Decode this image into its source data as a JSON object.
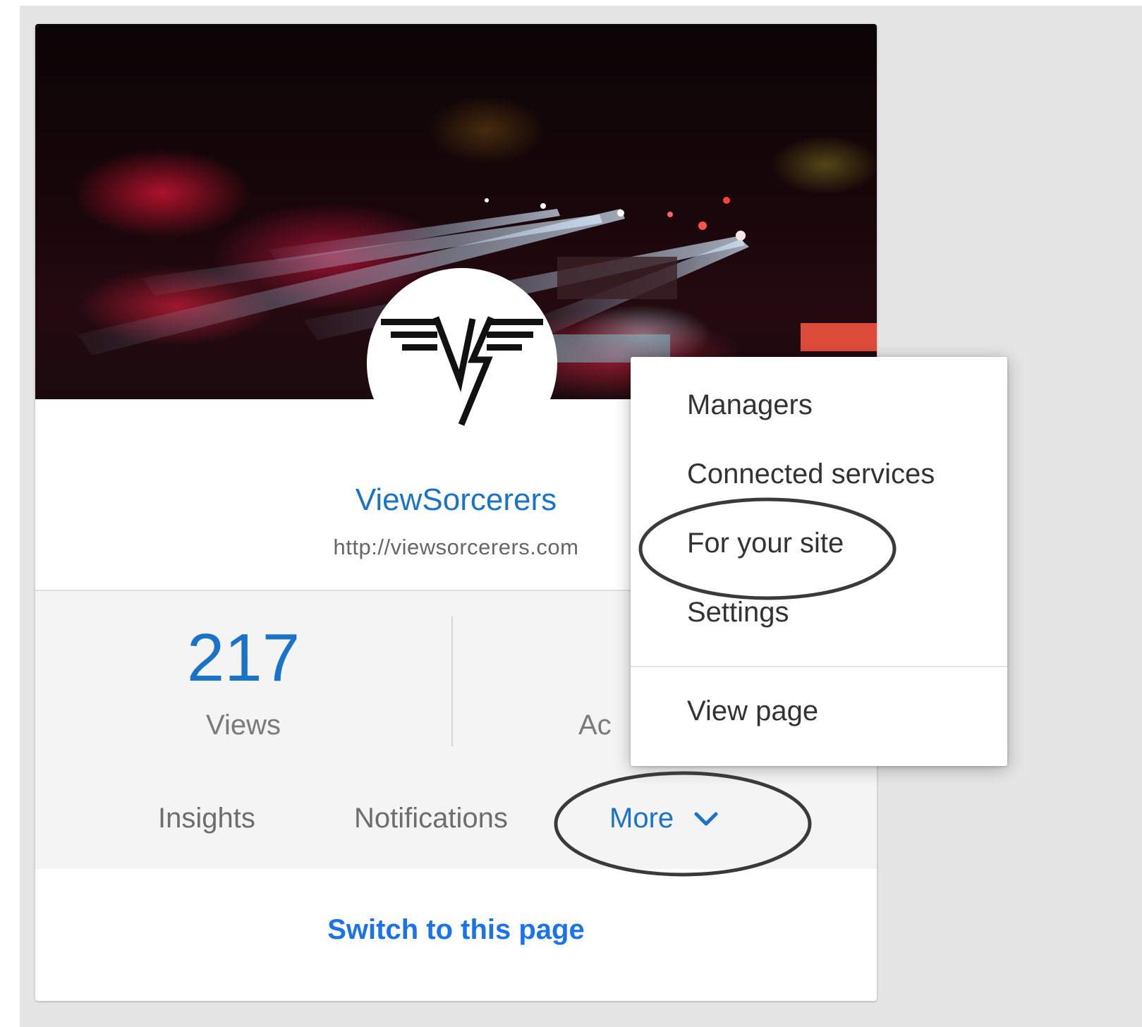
{
  "page": {
    "name": "ViewSorcerers",
    "url": "http://viewsorcerers.com"
  },
  "stats": {
    "views_value": "217",
    "views_label": "Views",
    "second_label_partial": "Ac"
  },
  "tabs": {
    "insights": "Insights",
    "notifications": "Notifications",
    "more": "More"
  },
  "footer": {
    "switch_link": "Switch to this page"
  },
  "menu": {
    "items": [
      {
        "label": "Managers"
      },
      {
        "label": "Connected services"
      },
      {
        "label": "For your site"
      },
      {
        "label": "Settings"
      },
      {
        "label": "View page"
      }
    ]
  },
  "icons": {
    "more_chevron": "chevron-down-icon",
    "avatar_logo": "vh-wing-logo"
  },
  "colors": {
    "accent_blue": "#1a73c9",
    "link_blue": "#1a73e8",
    "red_tab": "#dd4b39",
    "annotation_ring": "#3a3a3a"
  }
}
